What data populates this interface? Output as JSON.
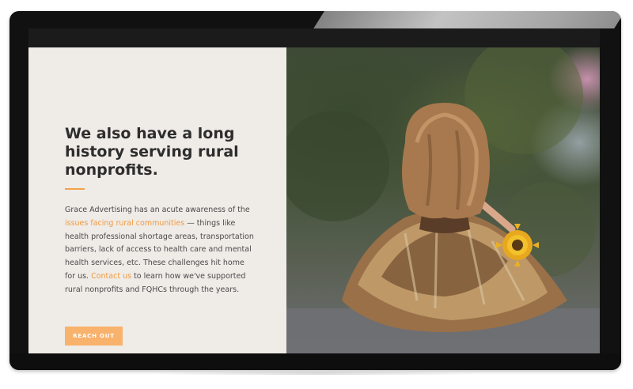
{
  "section": {
    "heading": "We also have a long history serving rural nonprofits.",
    "body": {
      "part1": "Grace Advertising has an acute awareness of the ",
      "link1": "issues facing rural communities",
      "part2": " — things like health professional shortage areas, transportation barriers, lack of access to health care and mental health services, etc. These challenges hit home for us. ",
      "link2": "Contact us",
      "part3": " to learn how we've supported rural nonprofits and FQHCs through the years."
    },
    "button_label": "REACH OUT"
  },
  "colors": {
    "accent": "#f5a24b",
    "button_bg": "#f8b26b",
    "panel_bg": "#efebe7",
    "heading": "#2d2d2d"
  }
}
